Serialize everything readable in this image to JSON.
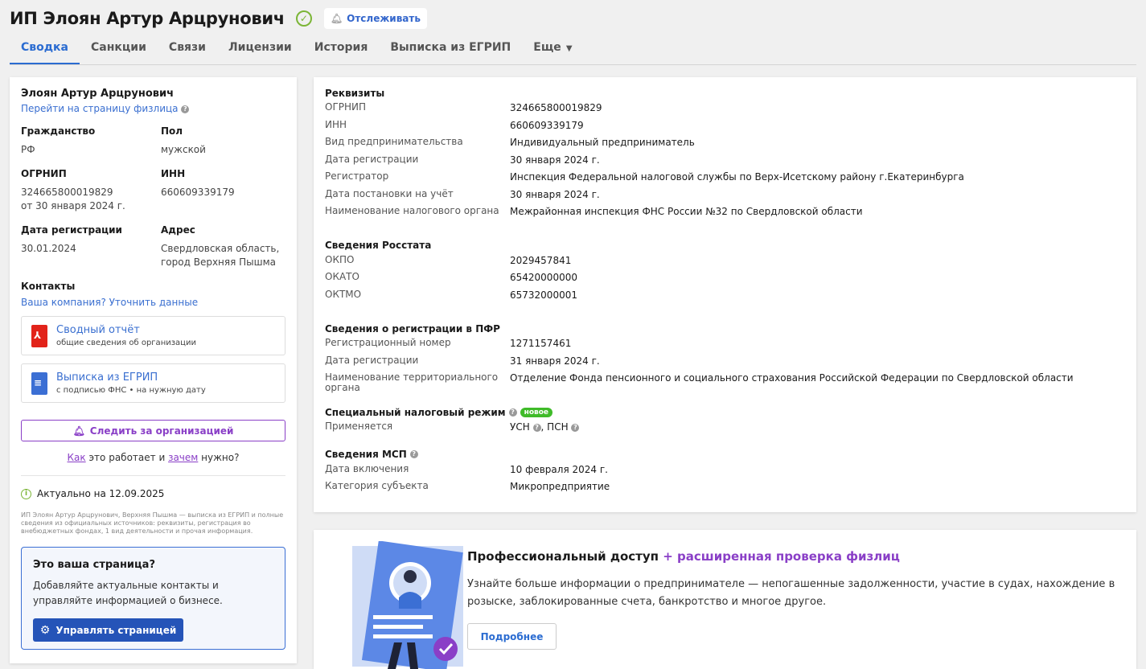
{
  "header": {
    "title": "ИП Элоян Артур Арцрунович",
    "follow_label": "Отслеживать"
  },
  "tabs": [
    {
      "label": "Сводка"
    },
    {
      "label": "Санкции"
    },
    {
      "label": "Связи"
    },
    {
      "label": "Лицензии"
    },
    {
      "label": "История"
    },
    {
      "label": "Выписка из ЕГРИП"
    },
    {
      "label": "Еще"
    }
  ],
  "left": {
    "name": "Элоян Артур Арцрунович",
    "person_link": "Перейти на страницу физлица",
    "citizenship_label": "Гражданство",
    "citizenship_value": "РФ",
    "sex_label": "Пол",
    "sex_value": "мужской",
    "ogrnip_label": "ОГРНИП",
    "ogrnip_value": "324665800019829",
    "ogrnip_date": "от 30 января 2024 г.",
    "inn_label": "ИНН",
    "inn_value": "660609339179",
    "regdate_label": "Дата регистрации",
    "regdate_value": "30.01.2024",
    "address_label": "Адрес",
    "address_line1": "Свердловская область,",
    "address_line2": "город Верхняя Пышма",
    "contacts_label": "Контакты",
    "contacts_link": "Ваша компания? Уточнить данные",
    "docs": [
      {
        "title": "Сводный отчёт",
        "sub": "общие сведения об организации"
      },
      {
        "title": "Выписка из ЕГРИП",
        "sub": "с подписью ФНС • на нужную дату"
      }
    ],
    "watch_label": "Следить за организацией",
    "how_a": "Как",
    "how_b": " это работает и ",
    "how_c": "зачем",
    "how_d": " нужно?",
    "actual": "Актуально на 12.09.2025",
    "fine_print": "ИП Элоян Артур Арцрунович, Верхняя Пышма — выписка из ЕГРИП и полные сведения из официальных источников: реквизиты, регистрация во внебюджетных фондах, 1 вид деятельности и прочая информация.",
    "own_title": "Это ваша страница?",
    "own_text": "Добавляйте актуальные контакты и управляйте информацией о бизнесе.",
    "manage_label": "Управлять страницей"
  },
  "details": {
    "requisites_title": "Реквизиты",
    "requisites": [
      {
        "k": "ОГРНИП",
        "v": "324665800019829"
      },
      {
        "k": "ИНН",
        "v": "660609339179"
      },
      {
        "k": "Вид предпринимательства",
        "v": "Индивидуальный предприниматель"
      },
      {
        "k": "Дата регистрации",
        "v": "30 января 2024 г."
      },
      {
        "k": "Регистратор",
        "v": "Инспекция Федеральной налоговой службы по Верх-Исетскому району г.Екатеринбурга"
      },
      {
        "k": "Дата постановки на учёт",
        "v": "30 января 2024 г."
      },
      {
        "k": "Наименование налогового органа",
        "v": "Межрайонная инспекция ФНС России №32 по Свердловской области"
      }
    ],
    "rosstat_title": "Сведения Росстата",
    "rosstat": [
      {
        "k": "ОКПО",
        "v": "2029457841"
      },
      {
        "k": "ОКАТО",
        "v": "65420000000"
      },
      {
        "k": "ОКТМО",
        "v": "65732000001"
      }
    ],
    "pfr_title": "Сведения о регистрации в ПФР",
    "pfr": [
      {
        "k": "Регистрационный номер",
        "v": "1271157461"
      },
      {
        "k": "Дата регистрации",
        "v": "31 января 2024 г."
      },
      {
        "k": "Наименование территориального органа",
        "v": "Отделение Фонда пенсионного и социального страхования Российской Федерации по Свердловской области"
      }
    ],
    "tax_title": "Специальный налоговый режим",
    "tax_badge": "новое",
    "tax_k": "Применяется",
    "tax_v1": "УСН",
    "tax_v2": ", ПСН",
    "msp_title": "Сведения МСП",
    "msp": [
      {
        "k": "Дата включения",
        "v": "10 февраля 2024 г."
      },
      {
        "k": "Категория субъекта",
        "v": "Микропредприятие"
      }
    ]
  },
  "promo": {
    "title_a": "Профессиональный доступ",
    "title_b": " + расширенная проверка физлиц",
    "text": "Узнайте больше информации о предпринимателе — непогашенные задолженности, участие в судах, нахождение в розыске, заблокированные счета, банкротство и многое другое.",
    "more_label": "Подробнее"
  }
}
